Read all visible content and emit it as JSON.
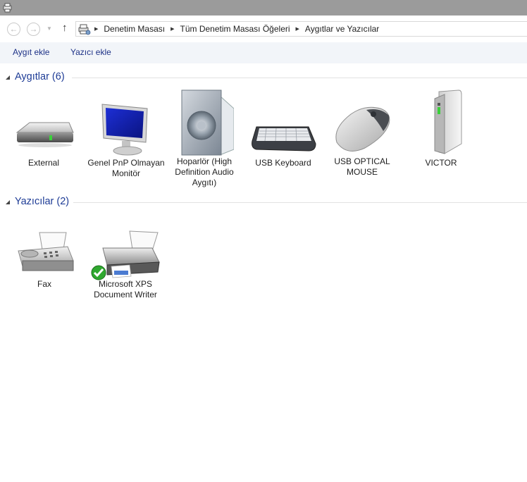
{
  "window": {
    "icon": "devices-printers-icon"
  },
  "nav": {
    "back_icon": "back-arrow-icon",
    "forward_icon": "forward-arrow-icon",
    "recent_icon": "chevron-down-icon",
    "up_icon": "up-arrow-icon",
    "address": {
      "icon": "devices-printers-icon",
      "crumbs": [
        "Denetim Masası",
        "Tüm Denetim Masası Öğeleri",
        "Aygıtlar ve Yazıcılar"
      ]
    }
  },
  "commands": {
    "add_device": "Aygıt ekle",
    "add_printer": "Yazıcı ekle"
  },
  "groups": {
    "devices": {
      "title": "Aygıtlar (6)",
      "items": [
        {
          "label": "External",
          "icon": "external-drive-icon"
        },
        {
          "label": "Genel PnP Olmayan Monitör",
          "icon": "monitor-icon"
        },
        {
          "label": "Hoparlör (High Definition Audio Aygıtı)",
          "icon": "speaker-icon"
        },
        {
          "label": "USB Keyboard",
          "icon": "keyboard-icon"
        },
        {
          "label": "USB OPTICAL MOUSE",
          "icon": "mouse-icon"
        },
        {
          "label": "VICTOR",
          "icon": "computer-tower-icon"
        }
      ]
    },
    "printers": {
      "title": "Yazıcılar (2)",
      "items": [
        {
          "label": "Fax",
          "icon": "fax-icon"
        },
        {
          "label": "Microsoft XPS Document Writer",
          "icon": "printer-icon",
          "badge": "default-checkmark-icon"
        }
      ]
    }
  }
}
